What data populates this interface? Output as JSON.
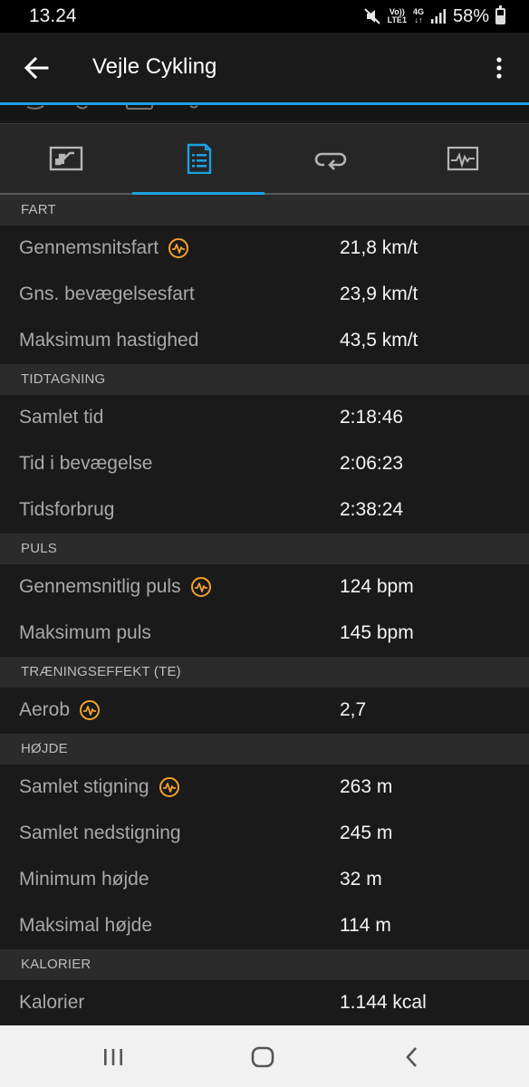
{
  "status_bar": {
    "time": "13.24",
    "volte_top": "Vo))",
    "volte_bottom": "LTE1",
    "network": "4G",
    "battery_percent": "58%",
    "battery_level": 0.58
  },
  "app_bar": {
    "title": "Vejle Cykling",
    "icons": [
      "arrow-back-icon",
      "more-vert-icon"
    ]
  },
  "tabs": [
    {
      "name": "overview",
      "icon": "map-chart-icon",
      "active": false
    },
    {
      "name": "stats",
      "icon": "document-list-icon",
      "active": true
    },
    {
      "name": "laps",
      "icon": "repeat-icon",
      "active": false
    },
    {
      "name": "graphs",
      "icon": "graph-icon",
      "active": false
    }
  ],
  "colors": {
    "accent": "#1ba1e2",
    "badge": "#f2a12a",
    "section_bg": "#2b2b2b",
    "row_bg": "#1a1a1a"
  },
  "sections": [
    {
      "header": "FART",
      "rows": [
        {
          "label": "Gennemsnitsfart",
          "value": "21,8 km/t",
          "badge": true
        },
        {
          "label": "Gns. bevægelsesfart",
          "value": "23,9 km/t",
          "badge": false
        },
        {
          "label": "Maksimum hastighed",
          "value": "43,5 km/t",
          "badge": false
        }
      ]
    },
    {
      "header": "TIDTAGNING",
      "rows": [
        {
          "label": "Samlet tid",
          "value": "2:18:46",
          "badge": false
        },
        {
          "label": "Tid i bevægelse",
          "value": "2:06:23",
          "badge": false
        },
        {
          "label": "Tidsforbrug",
          "value": "2:38:24",
          "badge": false
        }
      ]
    },
    {
      "header": "PULS",
      "rows": [
        {
          "label": "Gennemsnitlig puls",
          "value": "124 bpm",
          "badge": true
        },
        {
          "label": "Maksimum puls",
          "value": "145 bpm",
          "badge": false
        }
      ]
    },
    {
      "header": "TRÆNINGSEFFEKT (TE)",
      "rows": [
        {
          "label": "Aerob",
          "value": "2,7",
          "badge": true
        }
      ]
    },
    {
      "header": "HØJDE",
      "rows": [
        {
          "label": "Samlet stigning",
          "value": "263 m",
          "badge": true
        },
        {
          "label": "Samlet nedstigning",
          "value": "245 m",
          "badge": false
        },
        {
          "label": "Minimum højde",
          "value": "32 m",
          "badge": false
        },
        {
          "label": "Maksimal højde",
          "value": "114 m",
          "badge": false
        }
      ]
    },
    {
      "header": "KALORIER",
      "rows": [
        {
          "label": "Kalorier",
          "value": "1.144 kcal",
          "badge": false
        }
      ]
    }
  ],
  "nav_bar": {
    "icons": [
      "recent-apps-icon",
      "home-icon",
      "back-icon"
    ]
  }
}
